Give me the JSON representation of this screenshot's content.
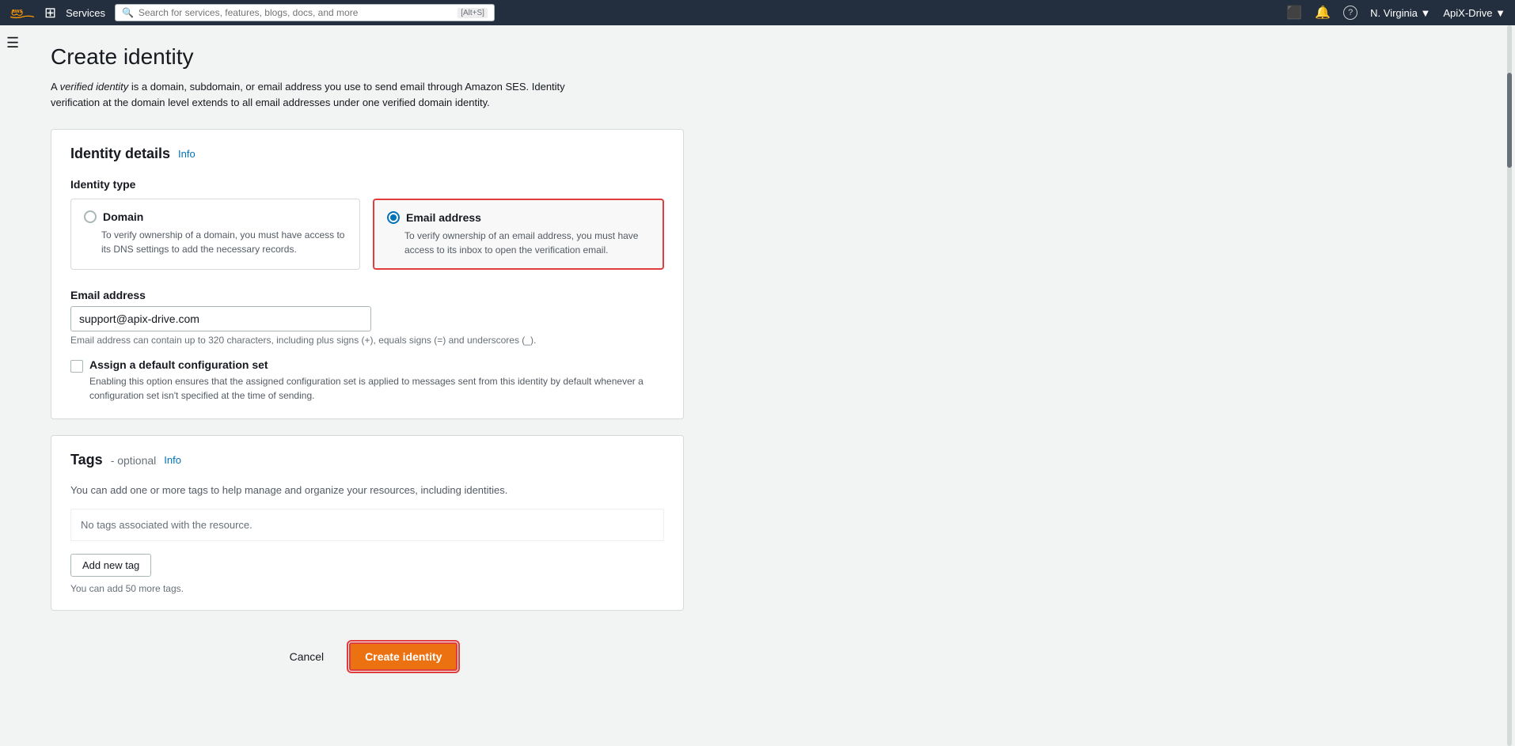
{
  "nav": {
    "aws_logo": "aws",
    "grid_icon": "⊞",
    "services_label": "Services",
    "search_placeholder": "Search for services, features, blogs, docs, and more",
    "search_shortcut": "[Alt+S]",
    "terminal_icon": "⬜",
    "bell_icon": "🔔",
    "help_icon": "?",
    "region_label": "N. Virginia ▼",
    "account_label": "ApiX-Drive ▼"
  },
  "sidebar": {
    "toggle_icon": "☰"
  },
  "page": {
    "title": "Create identity",
    "description_part1": "A ",
    "description_em": "verified identity",
    "description_part2": " is a domain, subdomain, or email address you use to send email through Amazon SES. Identity verification at the domain level extends to all email addresses under one verified domain identity."
  },
  "identity_details": {
    "card_title": "Identity details",
    "info_label": "Info",
    "identity_type_label": "Identity type",
    "domain_option": {
      "label": "Domain",
      "description": "To verify ownership of a domain, you must have access to its DNS settings to add the necessary records.",
      "selected": false
    },
    "email_option": {
      "label": "Email address",
      "description": "To verify ownership of an email address, you must have access to its inbox to open the verification email.",
      "selected": true
    },
    "email_address_label": "Email address",
    "email_address_value": "support@apix-drive.com",
    "email_hint": "Email address can contain up to 320 characters, including plus signs (+), equals signs (=) and underscores (_).",
    "config_set_label": "Assign a default configuration set",
    "config_set_desc": "Enabling this option ensures that the assigned configuration set is applied to messages sent from this identity by default whenever a configuration set isn't specified at the time of sending."
  },
  "tags": {
    "card_title": "Tags",
    "optional_label": "- optional",
    "info_label": "Info",
    "description": "You can add one or more tags to help manage and organize your resources, including identities.",
    "no_tags_label": "No tags associated with the resource.",
    "add_tag_label": "Add new tag",
    "tags_hint": "You can add 50 more tags."
  },
  "footer": {
    "cancel_label": "Cancel",
    "create_label": "Create identity"
  }
}
